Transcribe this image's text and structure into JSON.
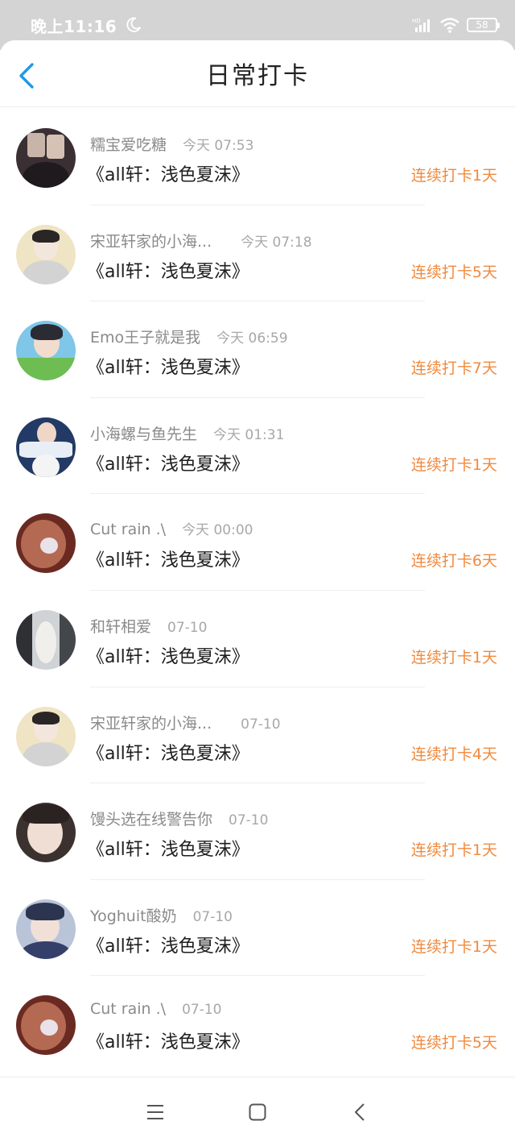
{
  "status_bar": {
    "time": "晚上11:16",
    "battery": "58",
    "signal_label": "HD"
  },
  "header": {
    "title": "日常打卡"
  },
  "colors": {
    "accent": "#1e9ae6",
    "streak": "#f08a3e",
    "status_bg": "#d4d4d4"
  },
  "entries": [
    {
      "name": "糯宝爱吃糖",
      "time": "今天 07:53",
      "book": "《all轩：浅色夏沫》",
      "streak": "连续打卡1天",
      "avatar": "avatar-1"
    },
    {
      "name": "宋亚轩家的小海...",
      "time": "今天 07:18",
      "book": "《all轩：浅色夏沫》",
      "streak": "连续打卡5天",
      "avatar": "avatar-2"
    },
    {
      "name": "Emo王子就是我",
      "time": "今天 06:59",
      "book": "《all轩：浅色夏沫》",
      "streak": "连续打卡7天",
      "avatar": "avatar-3"
    },
    {
      "name": "小海螺与鱼先生",
      "time": "今天 01:31",
      "book": "《all轩：浅色夏沫》",
      "streak": "连续打卡1天",
      "avatar": "avatar-4"
    },
    {
      "name": "Cut rain .\\",
      "time": "今天 00:00",
      "book": "《all轩：浅色夏沫》",
      "streak": "连续打卡6天",
      "avatar": "avatar-5"
    },
    {
      "name": "和轩相爱",
      "time": "07-10",
      "book": "《all轩：浅色夏沫》",
      "streak": "连续打卡1天",
      "avatar": "avatar-6"
    },
    {
      "name": "宋亚轩家的小海...",
      "time": "07-10",
      "book": "《all轩：浅色夏沫》",
      "streak": "连续打卡4天",
      "avatar": "avatar-7"
    },
    {
      "name": "馒头选在线警告你",
      "time": "07-10",
      "book": "《all轩：浅色夏沫》",
      "streak": "连续打卡1天",
      "avatar": "avatar-8"
    },
    {
      "name": "Yoghuit酸奶",
      "time": "07-10",
      "book": "《all轩：浅色夏沫》",
      "streak": "连续打卡1天",
      "avatar": "avatar-9"
    },
    {
      "name": "Cut rain .\\",
      "time": "07-10",
      "book": "《all轩：浅色夏沫》",
      "streak": "连续打卡5天",
      "avatar": "avatar-10"
    }
  ],
  "nav": {
    "menu_icon": "menu-icon",
    "home_icon": "home-square-icon",
    "back_icon": "back-triangle-icon"
  }
}
